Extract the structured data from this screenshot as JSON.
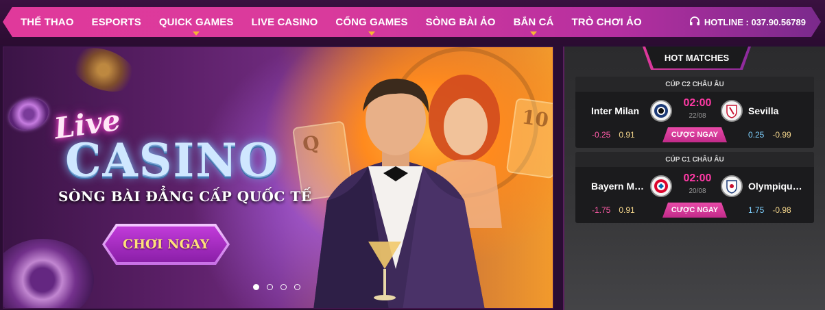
{
  "nav": {
    "items": [
      {
        "label": "THỂ THAO",
        "has_dropdown": false
      },
      {
        "label": "ESPORTS",
        "has_dropdown": false
      },
      {
        "label": "QUICK GAMES",
        "has_dropdown": true
      },
      {
        "label": "LIVE CASINO",
        "has_dropdown": false
      },
      {
        "label": "CỔNG GAMES",
        "has_dropdown": true
      },
      {
        "label": "SÒNG BÀI ẢO",
        "has_dropdown": false
      },
      {
        "label": "BẮN CÁ",
        "has_dropdown": true
      },
      {
        "label": "TRÒ CHƠI ẢO",
        "has_dropdown": false
      }
    ],
    "hotline": "HOTLINE : 037.90.56789",
    "hotline_icon": "headset-icon",
    "accent_color": "#e0399b",
    "caret_color": "#f5b733"
  },
  "banner": {
    "live": "Live",
    "casino": "CASINO",
    "subtitle": "SÒNG BÀI ĐẲNG CẤP QUỐC TẾ",
    "cta": "CHƠI NGAY",
    "card_q": "Q",
    "card_10": "10",
    "slides_total": 4,
    "active_slide": 1
  },
  "hot_matches": {
    "title": "HOT MATCHES",
    "bet_label": "CƯỢC NGAY",
    "matches": [
      {
        "league": "CÚP C2 CHÂU ÂU",
        "home": "Inter Milan",
        "away": "Sevilla",
        "time": "02:00",
        "date": "22/08",
        "home_handicap": "-0.25",
        "home_odds": "0.91",
        "away_handicap": "0.25",
        "away_odds": "-0.99",
        "home_crest": "inter-milan-crest-icon",
        "away_crest": "sevilla-crest-icon"
      },
      {
        "league": "CÚP C1 CHÂU ÂU",
        "home": "Bayern Munich",
        "away": "Olympique Lyon",
        "time": "02:00",
        "date": "20/08",
        "home_handicap": "-1.75",
        "home_odds": "0.91",
        "away_handicap": "1.75",
        "away_odds": "-0.98",
        "home_crest": "bayern-crest-icon",
        "away_crest": "lyon-crest-icon"
      }
    ]
  }
}
